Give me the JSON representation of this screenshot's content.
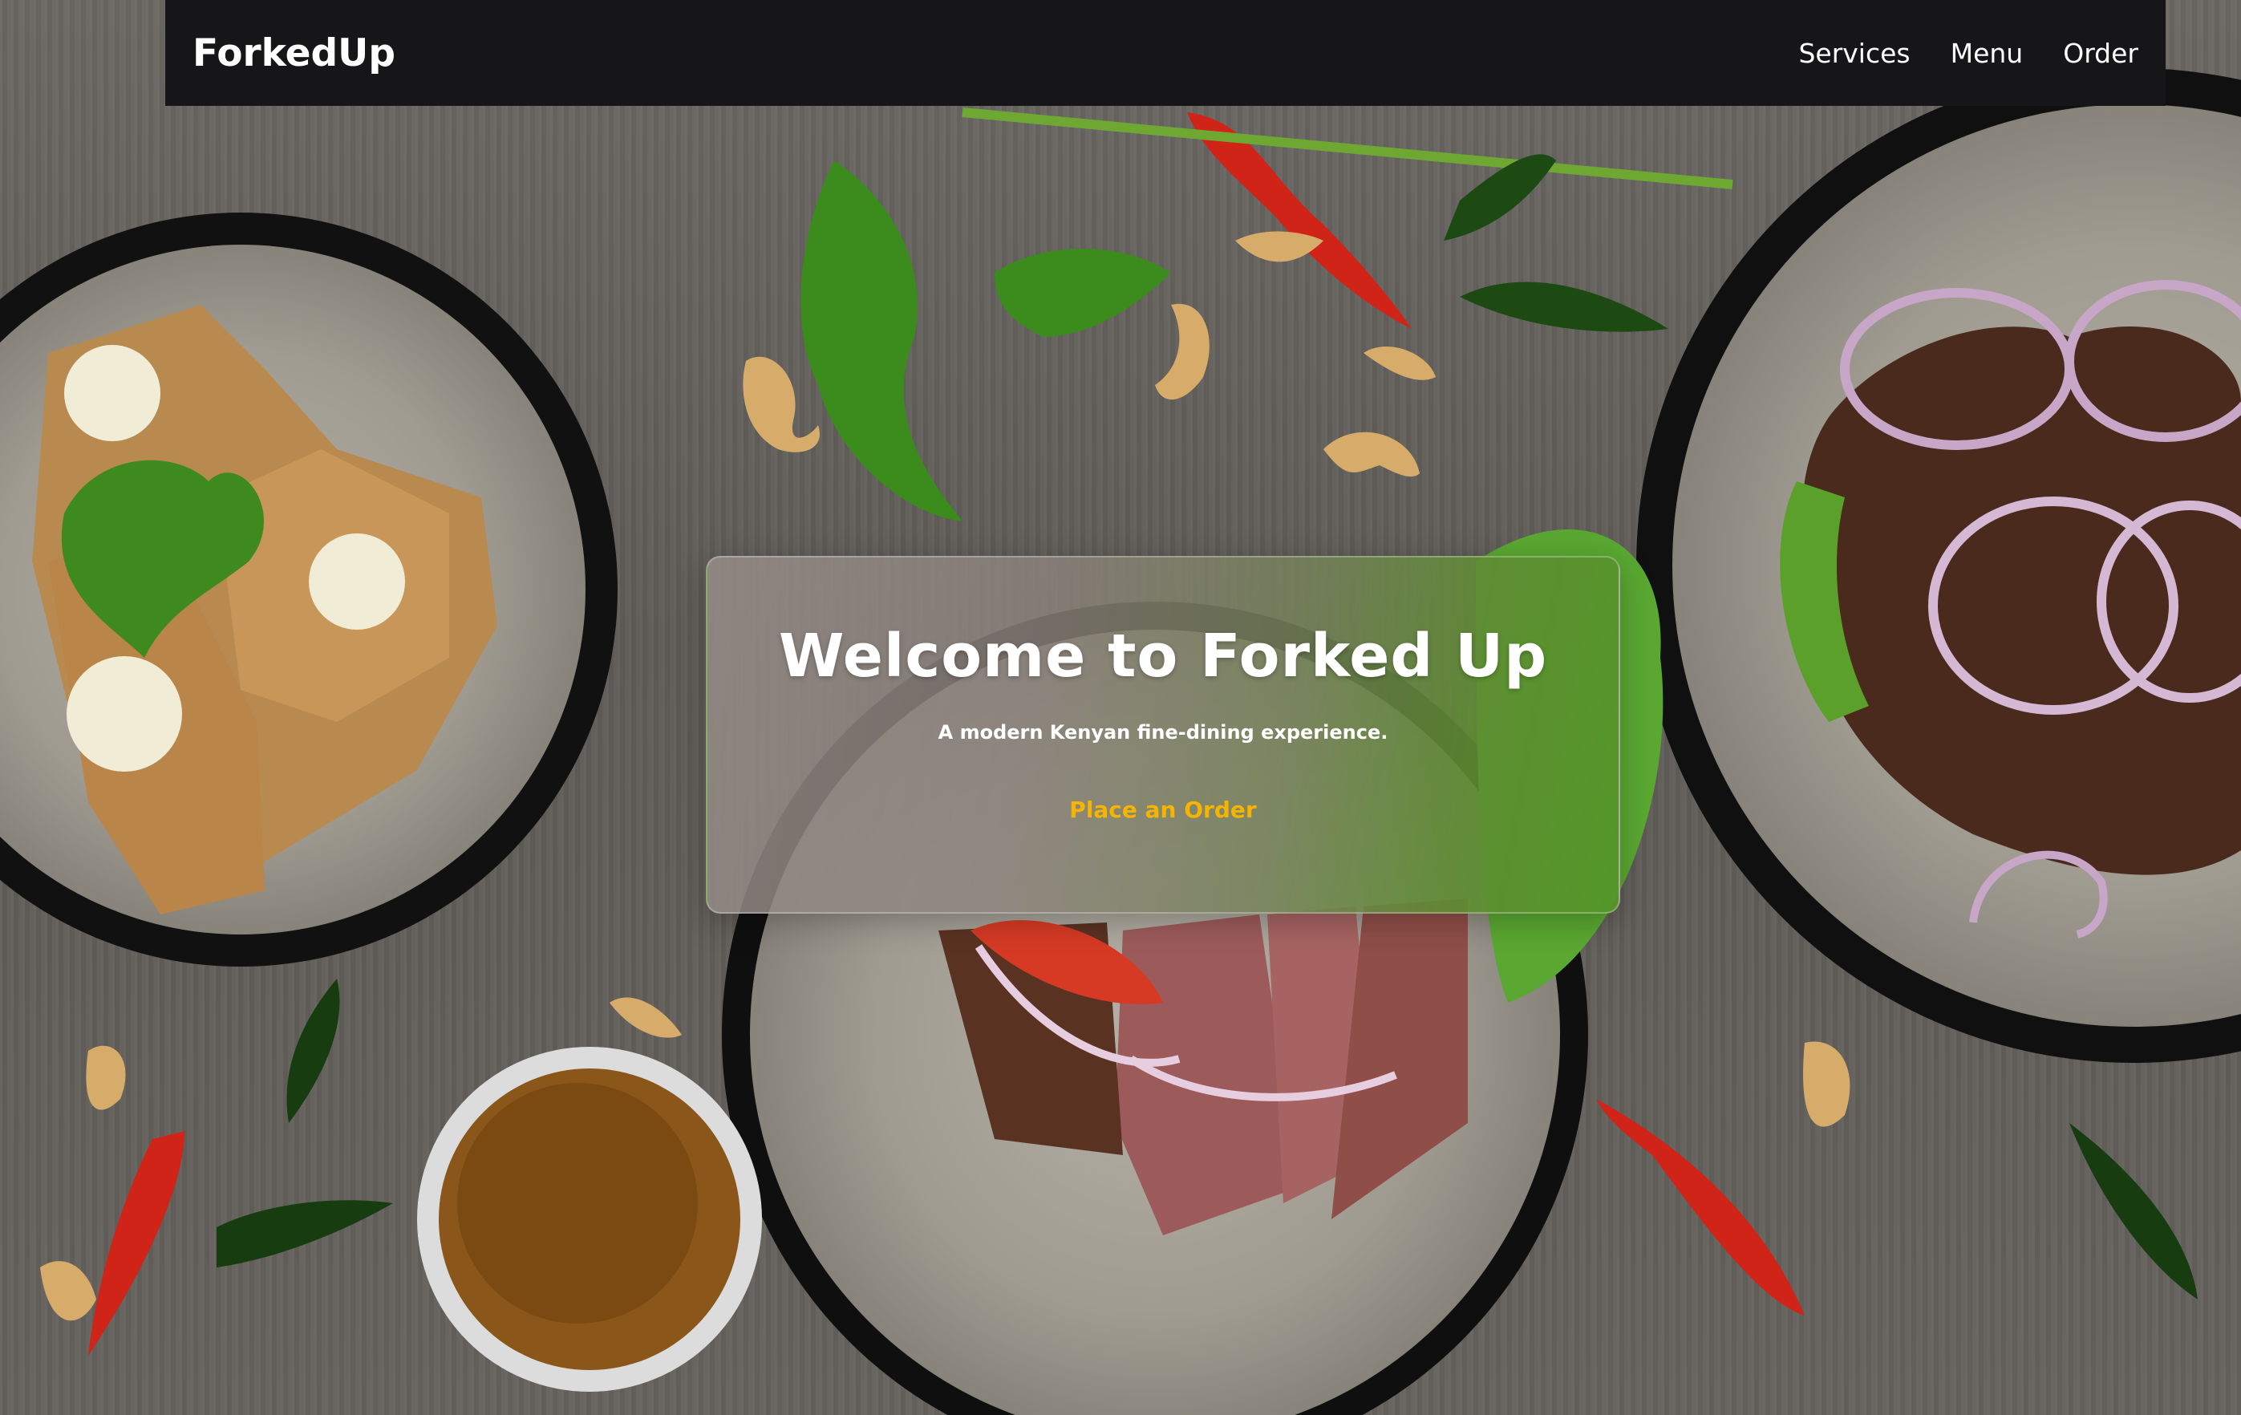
{
  "navbar": {
    "brand": "ForkedUp",
    "links": [
      "Services",
      "Menu",
      "Order"
    ]
  },
  "hero": {
    "title": "Welcome to Forked Up",
    "subtitle": "A modern Kenyan fine-dining experience.",
    "cta_label": "Place an Order"
  },
  "colors": {
    "navbar_bg": "#161618",
    "cta": "#f5b400",
    "card_green": "#5a9a30"
  }
}
